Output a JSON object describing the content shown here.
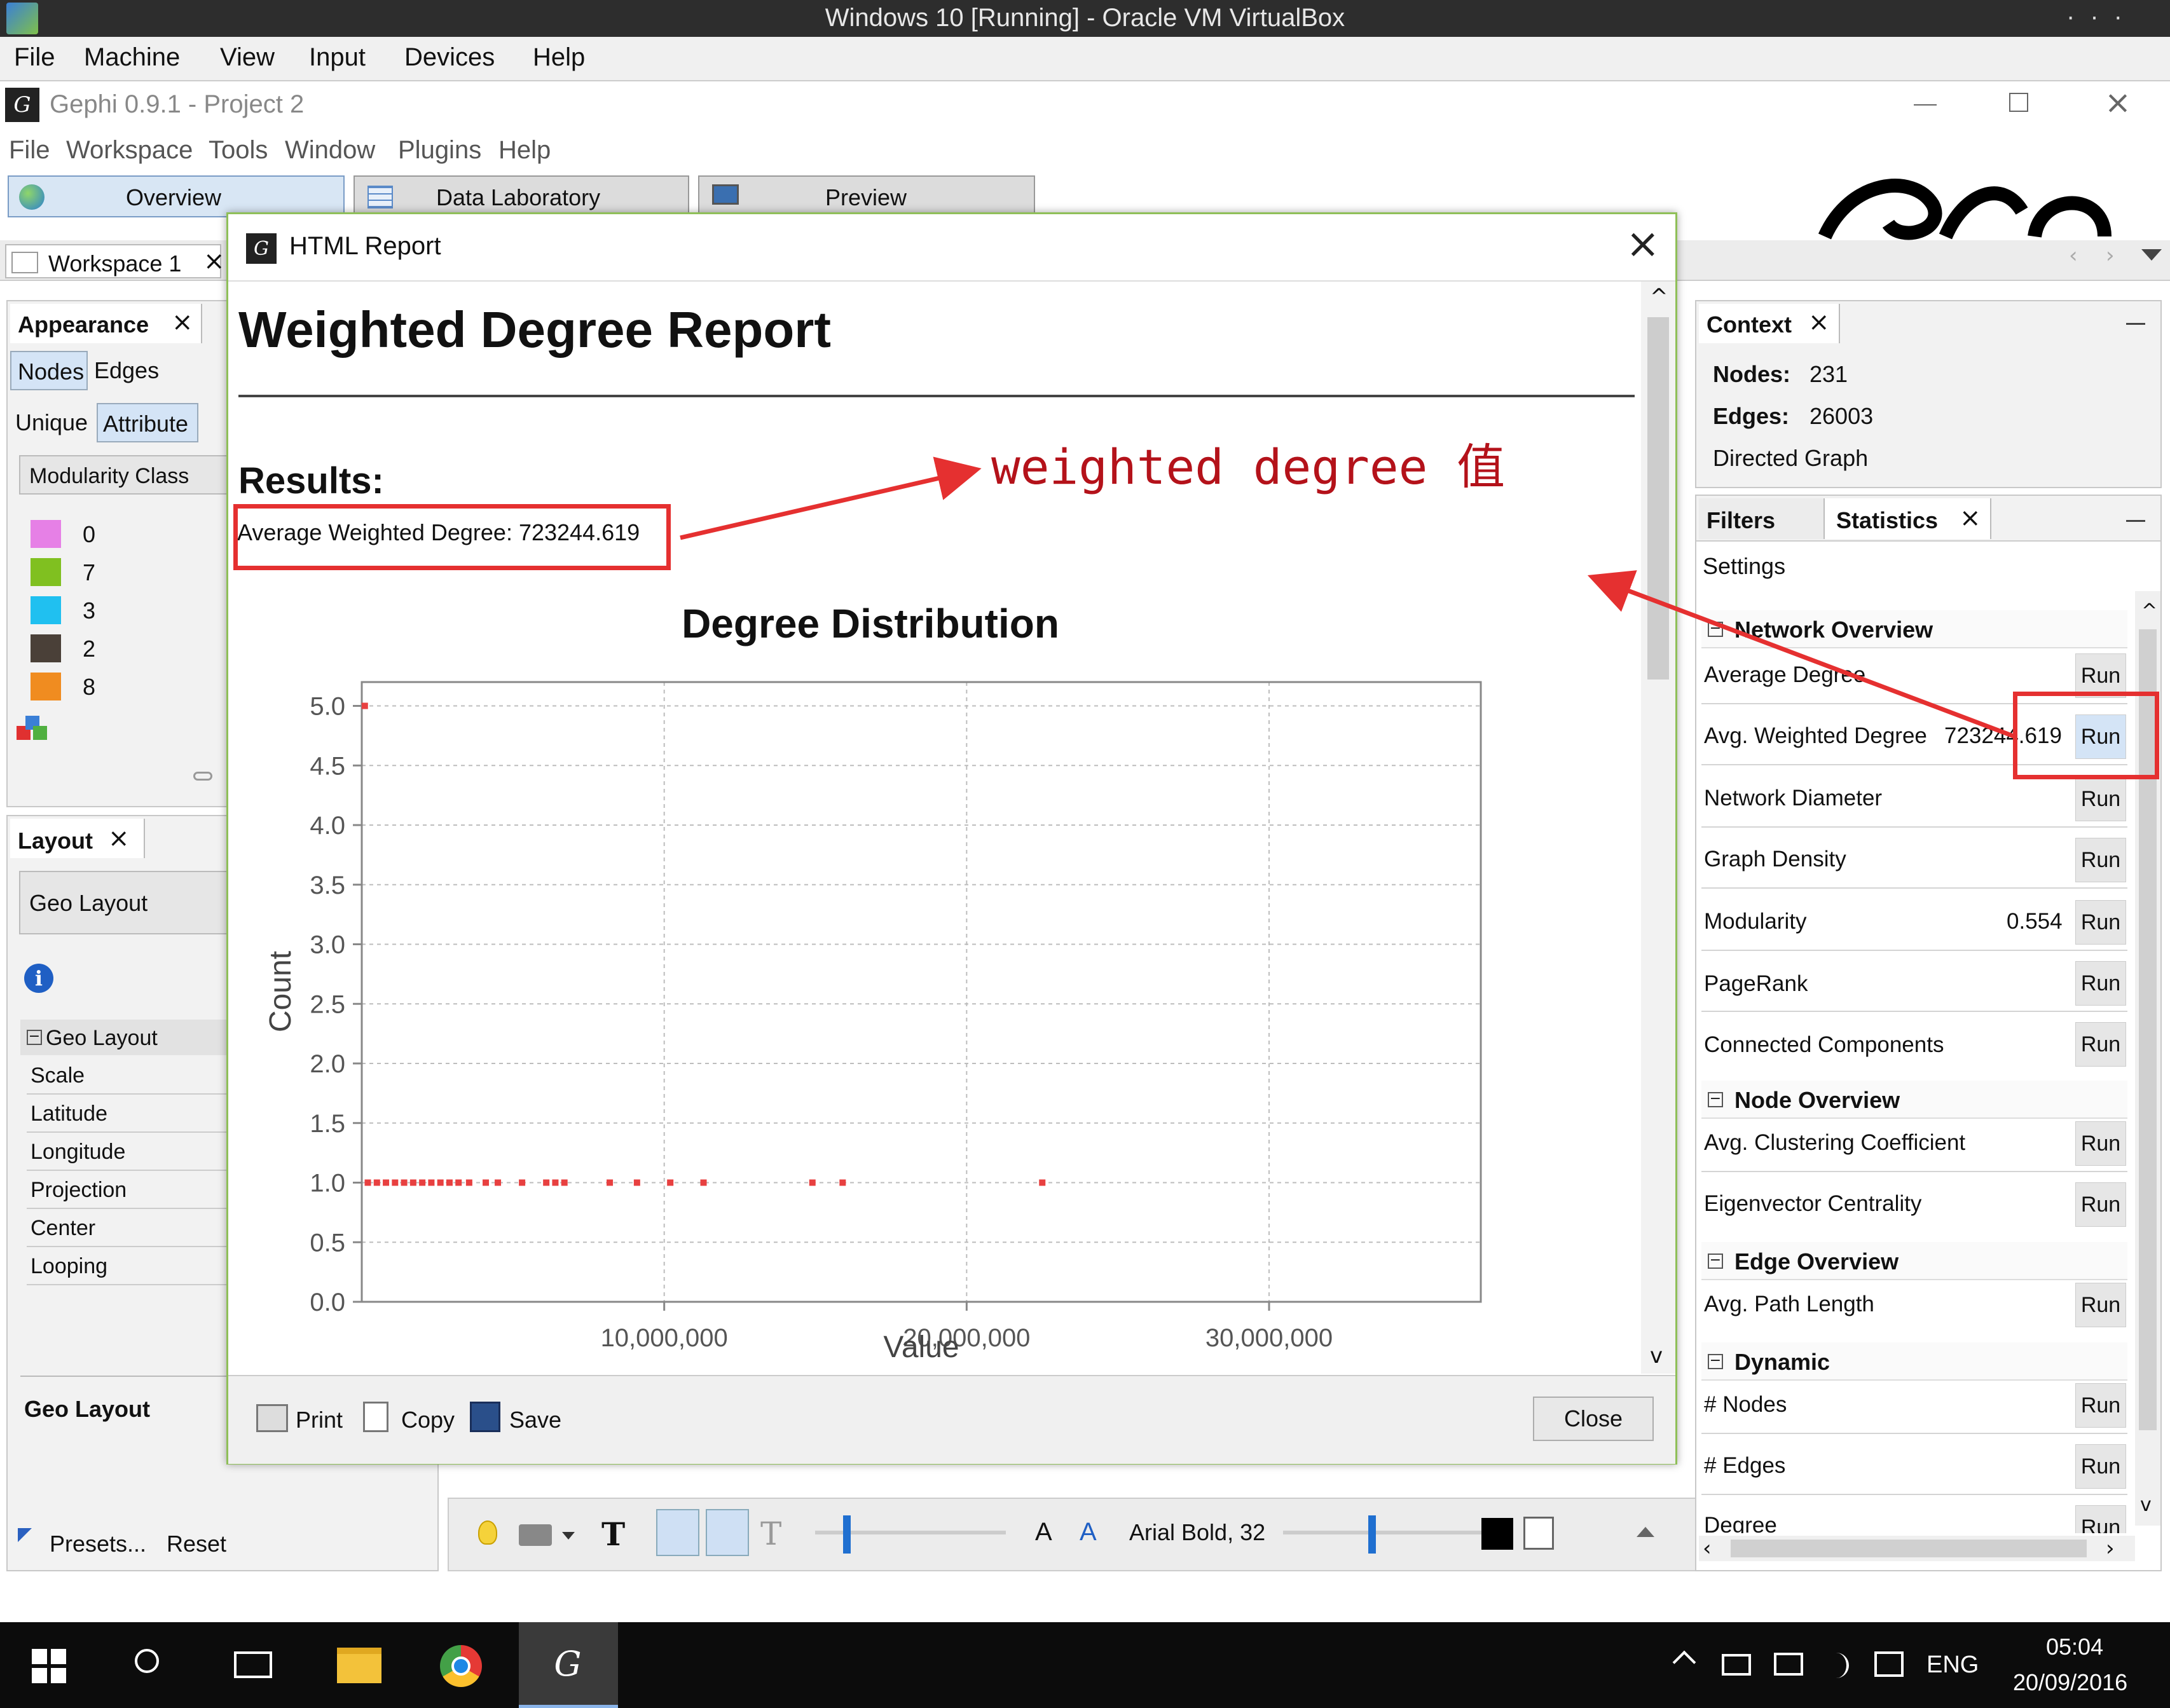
{
  "vbox": {
    "title": "Windows 10 [Running] - Oracle VM VirtualBox",
    "menu": [
      "File",
      "Machine",
      "View",
      "Input",
      "Devices",
      "Help"
    ]
  },
  "gephi": {
    "title": "Gephi 0.9.1 - Project 2",
    "menu": [
      "File",
      "Workspace",
      "Tools",
      "Window",
      "Plugins",
      "Help"
    ],
    "tabs": [
      "Overview",
      "Data Laboratory",
      "Preview"
    ],
    "workspace_tab": "Workspace 1"
  },
  "appearance": {
    "title": "Appearance",
    "tabs": [
      "Nodes",
      "Edges"
    ],
    "modes": [
      "Unique",
      "Attribute"
    ],
    "attribute": "Modularity Class",
    "partitions": [
      {
        "label": "0",
        "color": "#e680e6"
      },
      {
        "label": "7",
        "color": "#80c020"
      },
      {
        "label": "3",
        "color": "#20c0f0"
      },
      {
        "label": "2",
        "color": "#4a4038"
      },
      {
        "label": "8",
        "color": "#f08c20"
      }
    ]
  },
  "layout": {
    "title": "Layout",
    "selected": "Geo Layout",
    "group": "Geo Layout",
    "properties": [
      "Scale",
      "Latitude",
      "Longitude",
      "Projection",
      "Center",
      "Looping"
    ],
    "footer_title": "Geo Layout",
    "presets": "Presets...",
    "reset": "Reset"
  },
  "context": {
    "title": "Context",
    "nodes_label": "Nodes:",
    "nodes": "231",
    "edges_label": "Edges:",
    "edges": "26003",
    "graph_type": "Directed Graph"
  },
  "statistics": {
    "filters_tab": "Filters",
    "stats_tab": "Statistics",
    "settings": "Settings",
    "run": "Run",
    "groups": [
      {
        "title": "Network Overview"
      },
      {
        "title": "Node Overview"
      },
      {
        "title": "Edge Overview"
      },
      {
        "title": "Dynamic"
      }
    ],
    "rows": [
      {
        "label": "Average Degree",
        "value": ""
      },
      {
        "label": "Avg. Weighted Degree",
        "value": "723244.619"
      },
      {
        "label": "Network Diameter",
        "value": ""
      },
      {
        "label": "Graph Density",
        "value": ""
      },
      {
        "label": "Modularity",
        "value": "0.554"
      },
      {
        "label": "PageRank",
        "value": ""
      },
      {
        "label": "Connected Components",
        "value": ""
      },
      {
        "label": "Avg. Clustering Coefficient",
        "value": ""
      },
      {
        "label": "Eigenvector Centrality",
        "value": ""
      },
      {
        "label": "Avg. Path Length",
        "value": ""
      },
      {
        "label": "# Nodes",
        "value": ""
      },
      {
        "label": "# Edges",
        "value": ""
      },
      {
        "label": "Degree",
        "value": ""
      }
    ]
  },
  "toolbar": {
    "font": "Arial Bold, 32",
    "font_small": "A",
    "font_big": "A"
  },
  "dialog": {
    "title": "HTML Report",
    "report_title": "Weighted Degree Report",
    "results_label": "Results:",
    "avg_text": "Average Weighted Degree: 723244.619",
    "annotation": "weighted degree 值",
    "print": "Print",
    "copy": "Copy",
    "save": "Save",
    "close": "Close"
  },
  "chart_data": {
    "type": "scatter",
    "title": "Degree Distribution",
    "xlabel": "Value",
    "ylabel": "Count",
    "xlim": [
      0,
      37000000
    ],
    "ylim": [
      0,
      5.2
    ],
    "x_ticks": [
      10000000,
      20000000,
      30000000
    ],
    "x_tick_labels": [
      "10,000,000",
      "20,000,000",
      "30,000,000"
    ],
    "y_ticks": [
      0.0,
      0.5,
      1.0,
      1.5,
      2.0,
      2.5,
      3.0,
      3.5,
      4.0,
      4.5,
      5.0
    ],
    "y_tick_labels": [
      "0.0",
      "0.5",
      "1.0",
      "1.5",
      "2.0",
      "2.5",
      "3.0",
      "3.5",
      "4.0",
      "4.5",
      "5.0"
    ],
    "grid": true,
    "series_color": "#e84040",
    "points": [
      {
        "x": 100000,
        "y": 5
      },
      {
        "x": 200000,
        "y": 1
      },
      {
        "x": 500000,
        "y": 1
      },
      {
        "x": 800000,
        "y": 1
      },
      {
        "x": 1100000,
        "y": 1
      },
      {
        "x": 1400000,
        "y": 1
      },
      {
        "x": 1700000,
        "y": 1
      },
      {
        "x": 2000000,
        "y": 1
      },
      {
        "x": 2300000,
        "y": 1
      },
      {
        "x": 2600000,
        "y": 1
      },
      {
        "x": 2900000,
        "y": 1
      },
      {
        "x": 3200000,
        "y": 1
      },
      {
        "x": 3550000,
        "y": 1
      },
      {
        "x": 4100000,
        "y": 1
      },
      {
        "x": 4500000,
        "y": 1
      },
      {
        "x": 5300000,
        "y": 1
      },
      {
        "x": 6100000,
        "y": 1
      },
      {
        "x": 6400000,
        "y": 1
      },
      {
        "x": 6700000,
        "y": 1
      },
      {
        "x": 8200000,
        "y": 1
      },
      {
        "x": 9100000,
        "y": 1
      },
      {
        "x": 10200000,
        "y": 1
      },
      {
        "x": 11300000,
        "y": 1
      },
      {
        "x": 14900000,
        "y": 1
      },
      {
        "x": 15900000,
        "y": 1
      },
      {
        "x": 22500000,
        "y": 1
      }
    ]
  },
  "taskbar": {
    "lang": "ENG",
    "time": "05:04",
    "date": "20/09/2016"
  }
}
